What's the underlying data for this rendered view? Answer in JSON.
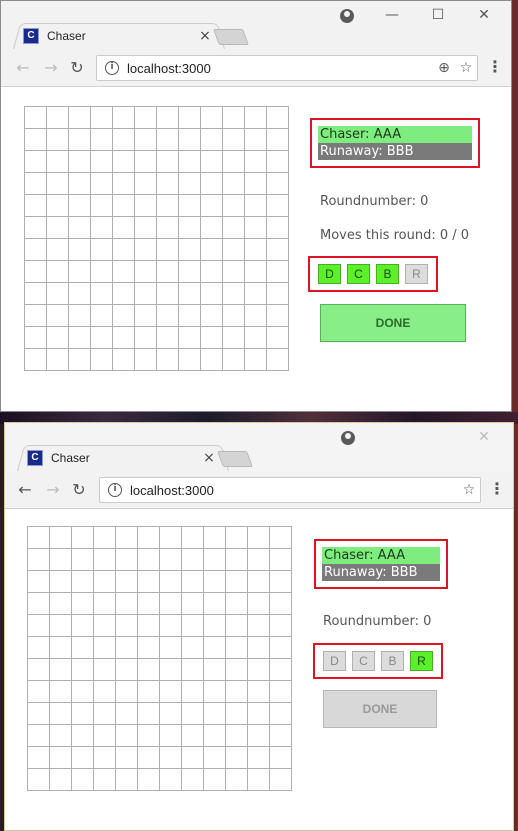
{
  "window_top": {
    "tab": {
      "favicon": "C",
      "title": "Chaser",
      "close": "×"
    },
    "controls": {
      "minimize": "—",
      "maximize": "☐",
      "close": "✕"
    },
    "toolbar": {
      "back": "←",
      "forward": "→",
      "reload": "↻",
      "url": "localhost:3000",
      "zoom_icon": "⊕",
      "star_icon": "☆",
      "menu": "⋮"
    },
    "players": {
      "chaser": "Chaser: AAA",
      "runaway": "Runaway: BBB"
    },
    "round_text": "Roundnumber: 0",
    "moves_text": "Moves this round: 0 / 0",
    "directions": [
      {
        "label": "D",
        "state": "active"
      },
      {
        "label": "C",
        "state": "active"
      },
      {
        "label": "B",
        "state": "active"
      },
      {
        "label": "R",
        "state": "inactive"
      }
    ],
    "done": {
      "label": "DONE",
      "state": "enabled"
    }
  },
  "window_bottom": {
    "tab": {
      "favicon": "C",
      "title": "Chaser",
      "close": "×"
    },
    "controls": {
      "close": "✕"
    },
    "toolbar": {
      "back": "←",
      "forward": "→",
      "reload": "↻",
      "url": "localhost:3000",
      "star_icon": "☆",
      "menu": "⋮"
    },
    "players": {
      "chaser": "Chaser: AAA",
      "runaway": "Runaway: BBB"
    },
    "round_text": "Roundnumber: 0",
    "directions": [
      {
        "label": "D",
        "state": "inactive"
      },
      {
        "label": "C",
        "state": "inactive"
      },
      {
        "label": "B",
        "state": "inactive"
      },
      {
        "label": "R",
        "state": "active"
      }
    ],
    "done": {
      "label": "DONE",
      "state": "disabled"
    }
  },
  "grid": {
    "rows": 12,
    "cols": 12
  },
  "colors": {
    "chaser_bg": "#7fec7f",
    "runaway_bg": "#7a7a7a",
    "active_dir": "#5cf02a",
    "highlight_border": "#e0141e",
    "done_enabled": "#88ee88",
    "done_disabled": "#d8d8d8"
  },
  "icons": {
    "favicon": "chaser-favicon-icon",
    "info": "info-icon",
    "profile": "profile-icon",
    "zoom": "zoom-icon",
    "star": "star-icon",
    "menu": "menu-dots-icon"
  }
}
